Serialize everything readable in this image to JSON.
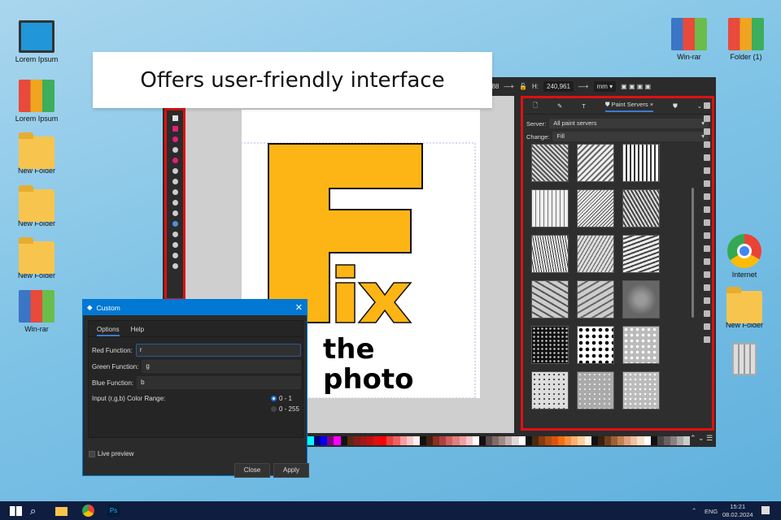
{
  "banner": {
    "text": "Offers user-friendly interface"
  },
  "desktop": {
    "left": [
      {
        "label": "Lorem Ipsum",
        "icon": "computer"
      },
      {
        "label": "Lorem Ipsum",
        "icon": "binders"
      },
      {
        "label": "New Folder",
        "icon": "folder"
      },
      {
        "label": "New Folder",
        "icon": "folder"
      },
      {
        "label": "New Folder",
        "icon": "folder"
      },
      {
        "label": "Win-rar",
        "icon": "winrar"
      }
    ],
    "right": [
      {
        "label": "Win-rar",
        "icon": "winrar"
      },
      {
        "label": "Folder (1)",
        "icon": "binders"
      },
      {
        "label": "Internet",
        "icon": "chrome"
      },
      {
        "label": "New Folder",
        "icon": "folder"
      },
      {
        "label": "",
        "icon": "recycle-bin"
      }
    ]
  },
  "toolbar": {
    "w_value": "988",
    "h_label": "H:",
    "h_value": "240,961",
    "unit": "mm",
    "ruler": "250"
  },
  "panel": {
    "tab_label": "Paint Servers",
    "tab_close": "×",
    "server_label": "Server:",
    "server_value": "All paint servers",
    "change_label": "Change:",
    "change_value": "Fill"
  },
  "logo": {
    "fix": "Fix",
    "the": "the",
    "photo": "photo"
  },
  "dialog": {
    "title": "Custom",
    "tabs": [
      "Options",
      "Help"
    ],
    "red_label": "Red Function:",
    "red_value": "r",
    "green_label": "Green Function:",
    "green_value": "g",
    "blue_label": "Blue Function:",
    "blue_value": "b",
    "range_label": "Input (r,g,b) Color Range:",
    "range_options": [
      "0 - 1",
      "0 - 255"
    ],
    "range_selected": "0 - 1",
    "live_preview": "Live preview",
    "close": "Close",
    "apply": "Apply"
  },
  "palette": [
    "#00ffff",
    "#000080",
    "#0000ff",
    "#800080",
    "#ff00ff",
    "#111",
    "#5a2a10",
    "#8b1a1a",
    "#a01818",
    "#c01010",
    "#e01010",
    "#ff0000",
    "#e84040",
    "#f06060",
    "#f4a0a0",
    "#f8c8c8",
    "#fff0f0",
    "#111",
    "#4a2010",
    "#8a3020",
    "#b04040",
    "#d06060",
    "#e08080",
    "#f0a0a0",
    "#f8c8c8",
    "#fff",
    "#111",
    "#5a4a48",
    "#806a68",
    "#a08a88",
    "#c0b0b0",
    "#e0d8d8",
    "#fff",
    "#111",
    "#4a2a10",
    "#8a3a10",
    "#b05010",
    "#e05010",
    "#f07010",
    "#f89040",
    "#fbb070",
    "#fcd0a0",
    "#fff0e0",
    "#111",
    "#3a2010",
    "#704020",
    "#a06030",
    "#c08050",
    "#e0a080",
    "#f0c0a0",
    "#f8e0c8",
    "#fff",
    "#111",
    "#4a4444",
    "#6a6060",
    "#8a8080",
    "#aaa",
    "#ccc"
  ],
  "taskbar": {
    "lang": "ENG",
    "time": "15:21",
    "date": "08.02.2024"
  }
}
